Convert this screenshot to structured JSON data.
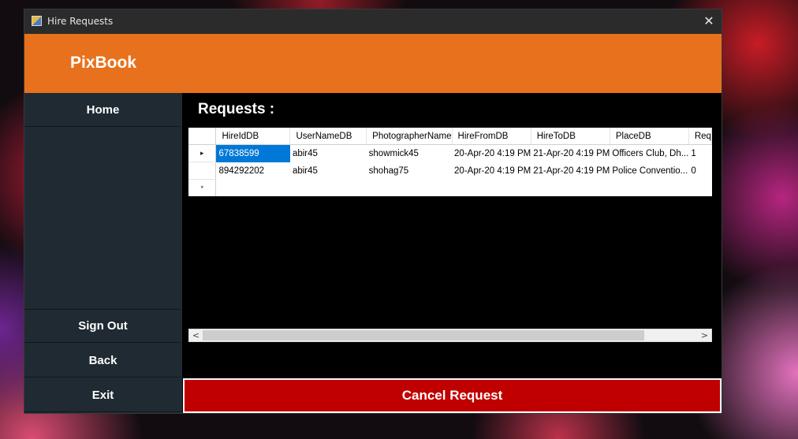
{
  "window": {
    "title": "Hire Requests",
    "close_glyph": "✕"
  },
  "header": {
    "brand": "PixBook",
    "brand_color": "#e8711d"
  },
  "sidebar": {
    "home": "Home",
    "signout": "Sign Out",
    "back": "Back",
    "exit": "Exit"
  },
  "main": {
    "title": "Requests :"
  },
  "grid": {
    "columns": [
      "HireIdDB",
      "UserNameDB",
      "PhotographerName",
      "HireFromDB",
      "HireToDB",
      "PlaceDB",
      "Req"
    ],
    "rows": [
      {
        "indicator": "▸",
        "cells": [
          "67838599",
          "abir45",
          "showmick45",
          "20-Apr-20 4:19 PM",
          "21-Apr-20 4:19 PM",
          "Officers Club, Dh...",
          "1"
        ]
      },
      {
        "indicator": "",
        "cells": [
          "894292202",
          "abir45",
          "shohag75",
          "20-Apr-20 4:19 PM",
          "21-Apr-20 4:19 PM",
          "Police Conventio...",
          "0"
        ]
      }
    ],
    "new_row_indicator": "*",
    "scroll_left": "<",
    "scroll_right": ">"
  },
  "actions": {
    "cancel_request": "Cancel Request",
    "cancel_color": "#c00000"
  }
}
